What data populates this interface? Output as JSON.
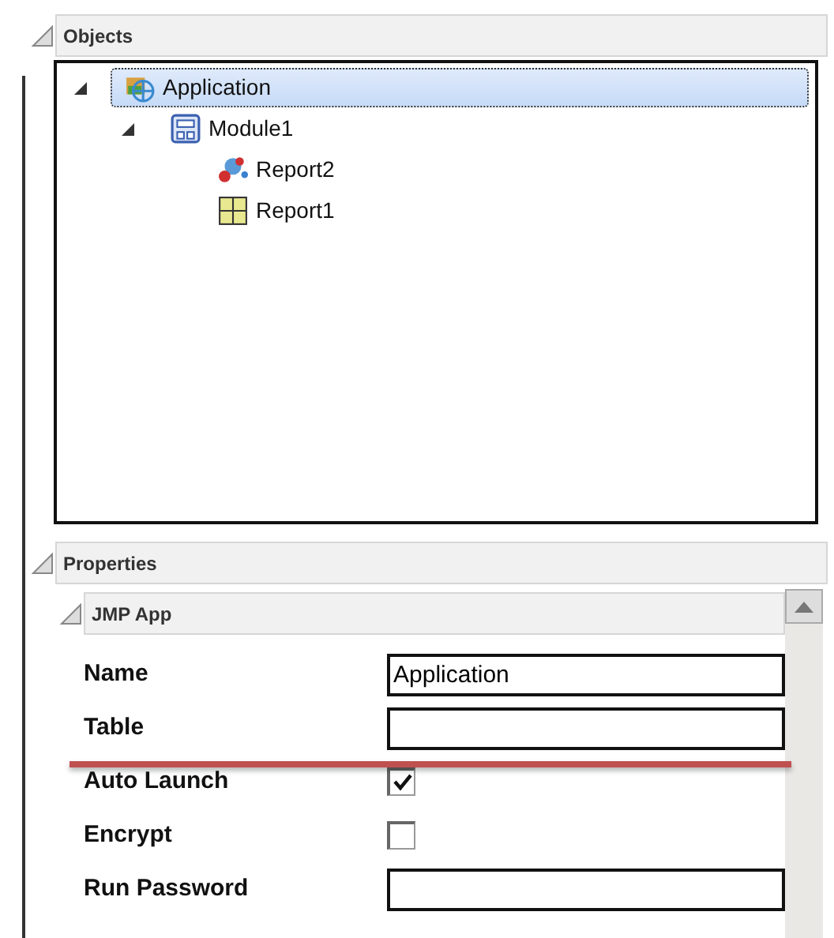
{
  "objects_panel": {
    "title": "Objects",
    "expanded": true,
    "tree": [
      {
        "label": "Application",
        "kind": "application",
        "selected": true,
        "expanded": true,
        "children": [
          {
            "label": "Module1",
            "kind": "module",
            "selected": false,
            "expanded": true,
            "children": [
              {
                "label": "Report2",
                "kind": "chart",
                "selected": false
              },
              {
                "label": "Report1",
                "kind": "table",
                "selected": false
              }
            ]
          }
        ]
      }
    ]
  },
  "properties_panel": {
    "title": "Properties",
    "expanded": true,
    "group": {
      "title": "JMP App",
      "expanded": true
    },
    "rows": [
      {
        "kind": "text",
        "label": "Name",
        "value": "Application"
      },
      {
        "kind": "text",
        "label": "Table"
      },
      {
        "kind": "checkbox",
        "label": "Auto Launch",
        "checked": true
      },
      {
        "kind": "checkbox",
        "label": "Encrypt",
        "checked": false
      },
      {
        "kind": "text",
        "label": "Run Password"
      }
    ]
  }
}
